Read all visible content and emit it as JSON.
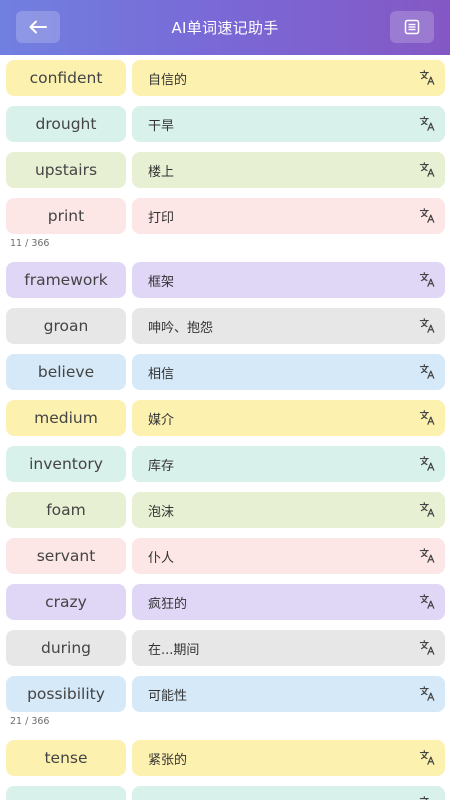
{
  "header": {
    "title": "AI单词速记助手",
    "back_icon": "arrow-left-icon",
    "list_icon": "list-icon"
  },
  "colors": {
    "yellow": "#fdf1b0",
    "mint": "#d8f1ea",
    "lime": "#e8f0d4",
    "pink": "#fde6e6",
    "purple": "#e0d6f6",
    "gray": "#e7e7e7",
    "blue": "#d6e9f8"
  },
  "rows": [
    {
      "word": "confident",
      "meaning": "自信的",
      "color": "yellow"
    },
    {
      "word": "drought",
      "meaning": "干旱",
      "color": "mint"
    },
    {
      "word": "upstairs",
      "meaning": "楼上",
      "color": "lime"
    },
    {
      "word": "print",
      "meaning": "打印",
      "color": "pink"
    },
    {
      "counter": "11 / 366"
    },
    {
      "word": "framework",
      "meaning": "框架",
      "color": "purple"
    },
    {
      "word": "groan",
      "meaning": "呻吟、抱怨",
      "color": "gray"
    },
    {
      "word": "believe",
      "meaning": "相信",
      "color": "blue"
    },
    {
      "word": "medium",
      "meaning": "媒介",
      "color": "yellow"
    },
    {
      "word": "inventory",
      "meaning": "库存",
      "color": "mint"
    },
    {
      "word": "foam",
      "meaning": "泡沫",
      "color": "lime"
    },
    {
      "word": "servant",
      "meaning": "仆人",
      "color": "pink"
    },
    {
      "word": "crazy",
      "meaning": "疯狂的",
      "color": "purple"
    },
    {
      "word": "during",
      "meaning": "在...期间",
      "color": "gray"
    },
    {
      "word": "possibility",
      "meaning": "可能性",
      "color": "blue"
    },
    {
      "counter": "21 / 366"
    },
    {
      "word": "tense",
      "meaning": "紧张的",
      "color": "yellow"
    },
    {
      "word": "",
      "meaning": "",
      "color": "mint"
    }
  ]
}
